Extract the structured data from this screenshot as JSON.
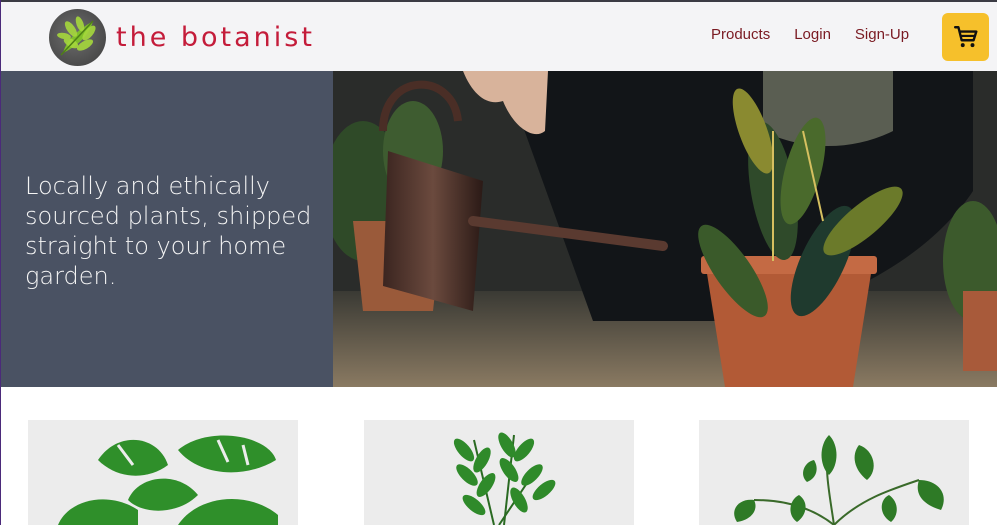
{
  "brand": {
    "name": "the botanist",
    "logo_icon": "leaf-logo-icon"
  },
  "nav": {
    "products_label": "Products",
    "login_label": "Login",
    "signup_label": "Sign-Up",
    "cart_icon": "cart-icon"
  },
  "hero": {
    "tagline": "Locally and ethically sourced plants, shipped straight to your home garden."
  },
  "products": [
    {
      "image": "monstera-plant-image"
    },
    {
      "image": "zz-plant-image"
    },
    {
      "image": "philodendron-plant-image"
    }
  ],
  "colors": {
    "header_bg": "#f4f4f6",
    "brand_red": "#c41c3a",
    "nav_text": "#7a1a22",
    "cart_yellow": "#f6c02b",
    "hero_panel": "#4a5263"
  }
}
